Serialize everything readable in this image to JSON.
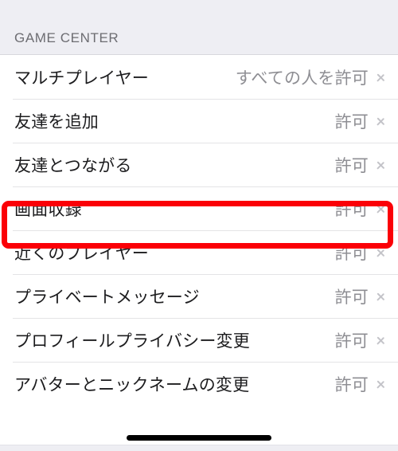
{
  "section": {
    "header_label": "GAME CENTER"
  },
  "rows": [
    {
      "label": "マルチプレイヤー",
      "value": "すべての人を許可",
      "accessory": "chevron-right-icon",
      "highlighted": false
    },
    {
      "label": "友達を追加",
      "value": "許可",
      "accessory": "chevron-right-icon",
      "highlighted": false
    },
    {
      "label": "友達とつながる",
      "value": "許可",
      "accessory": "chevron-right-icon",
      "highlighted": false
    },
    {
      "label": "画面収録",
      "value": "許可",
      "accessory": "chevron-right-icon",
      "highlighted": true
    },
    {
      "label": "近くのプレイヤー",
      "value": "許可",
      "accessory": "chevron-right-icon",
      "highlighted": false
    },
    {
      "label": "プライベートメッセージ",
      "value": "許可",
      "accessory": "chevron-right-icon",
      "highlighted": false
    },
    {
      "label": "プロフィールプライバシー変更",
      "value": "許可",
      "accessory": "chevron-right-icon",
      "highlighted": false
    },
    {
      "label": "アバターとニックネームの変更",
      "value": "許可",
      "accessory": "chevron-right-icon",
      "highlighted": false
    }
  ],
  "annotation": {
    "type": "rectangle-highlight",
    "color": "#fb0007",
    "target_row_label": "画面収録"
  },
  "colors": {
    "header_background": "#eeeef3",
    "row_background": "#ffffff",
    "separator": "#e4e4e6",
    "label_text": "#1c1c1e",
    "value_text": "#8e8e93",
    "header_text": "#6d6d72",
    "chevron": "#c4c4c9",
    "home_indicator": "#000000"
  }
}
